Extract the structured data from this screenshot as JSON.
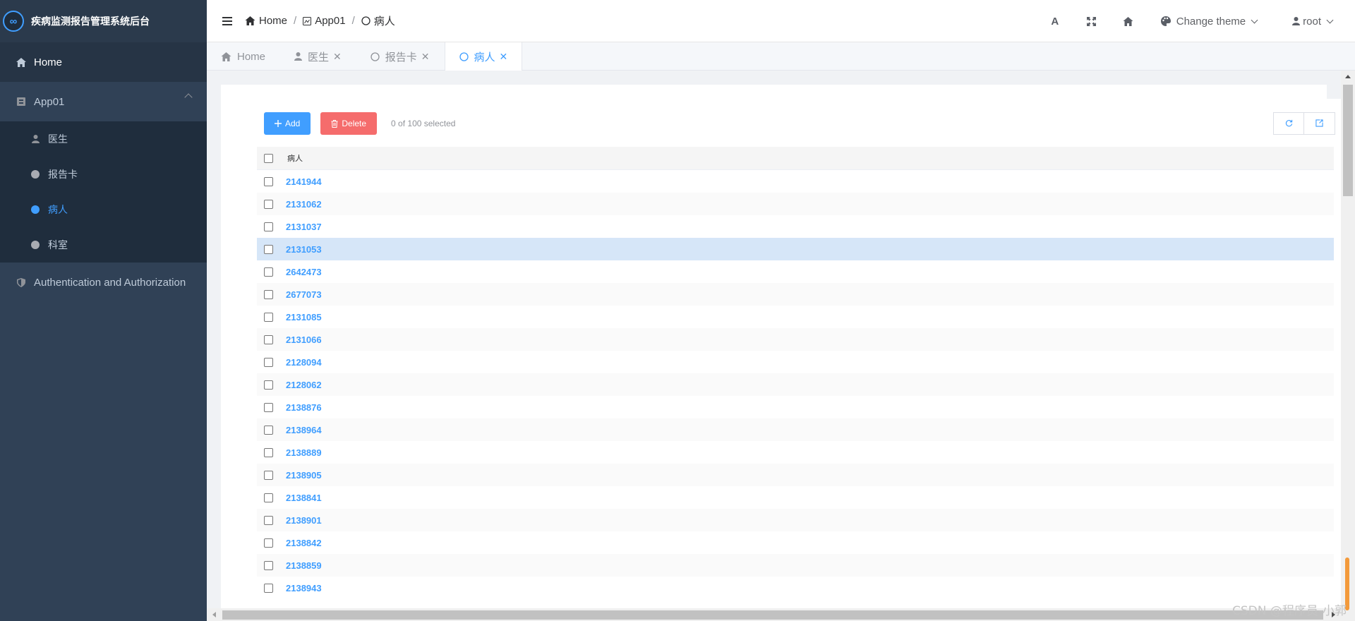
{
  "app_title": "疾病监测报告管理系统后台",
  "sidebar": {
    "home": "Home",
    "app01": "App01",
    "sub_items": [
      {
        "label": "医生",
        "icon": "person-icon"
      },
      {
        "label": "报告卡",
        "icon": "circle-icon"
      },
      {
        "label": "病人",
        "icon": "circle-icon",
        "active": true
      },
      {
        "label": "科室",
        "icon": "circle-icon"
      }
    ],
    "auth": "Authentication and Authorization"
  },
  "breadcrumb": [
    {
      "label": "Home",
      "icon": "home-icon"
    },
    {
      "label": "App01",
      "icon": "app-icon"
    },
    {
      "label": "病人",
      "icon": "circle-outline-icon"
    }
  ],
  "navbar": {
    "font_icon": "A",
    "theme_label": "Change theme",
    "user_label": "root"
  },
  "tabs": [
    {
      "label": "Home",
      "icon": "home-icon",
      "closable": false
    },
    {
      "label": "医生",
      "icon": "person-icon",
      "closable": true
    },
    {
      "label": "报告卡",
      "icon": "circle-outline-icon",
      "closable": true
    },
    {
      "label": "病人",
      "icon": "circle-outline-icon",
      "closable": true,
      "active": true
    }
  ],
  "toolbar": {
    "add_label": "Add",
    "delete_label": "Delete",
    "selected_text": "0 of 100 selected"
  },
  "table": {
    "header": "病人",
    "rows": [
      "2141944",
      "2131062",
      "2131037",
      "2131053",
      "2642473",
      "2677073",
      "2131085",
      "2131066",
      "2128094",
      "2128062",
      "2138876",
      "2138964",
      "2138889",
      "2138905",
      "2138841",
      "2138901",
      "2138842",
      "2138859",
      "2138943"
    ],
    "highlighted_index": 3
  },
  "watermark": "CSDN @程序员-小郭",
  "colors": {
    "accent": "#409eff",
    "danger": "#f56c6c",
    "sidebar_bg": "#304156",
    "highlight_row": "#d6e6f8"
  }
}
